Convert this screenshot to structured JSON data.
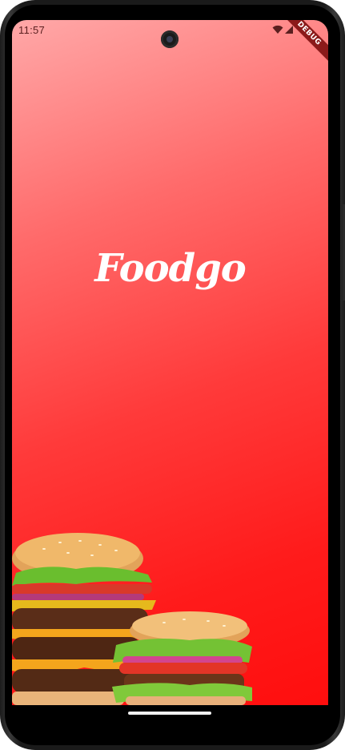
{
  "status_bar": {
    "time": "11:57",
    "wifi_icon": "wifi-icon",
    "signal_icon": "cellular-signal-icon"
  },
  "debug_banner": {
    "label": "DEBUG"
  },
  "splash": {
    "logo_text": "Foodgo",
    "background_gradient": [
      "#ffa8a8",
      "#ff0e0e"
    ],
    "image": "burgers-illustration"
  },
  "navigation": {
    "home_indicator_icon": "home-indicator"
  }
}
